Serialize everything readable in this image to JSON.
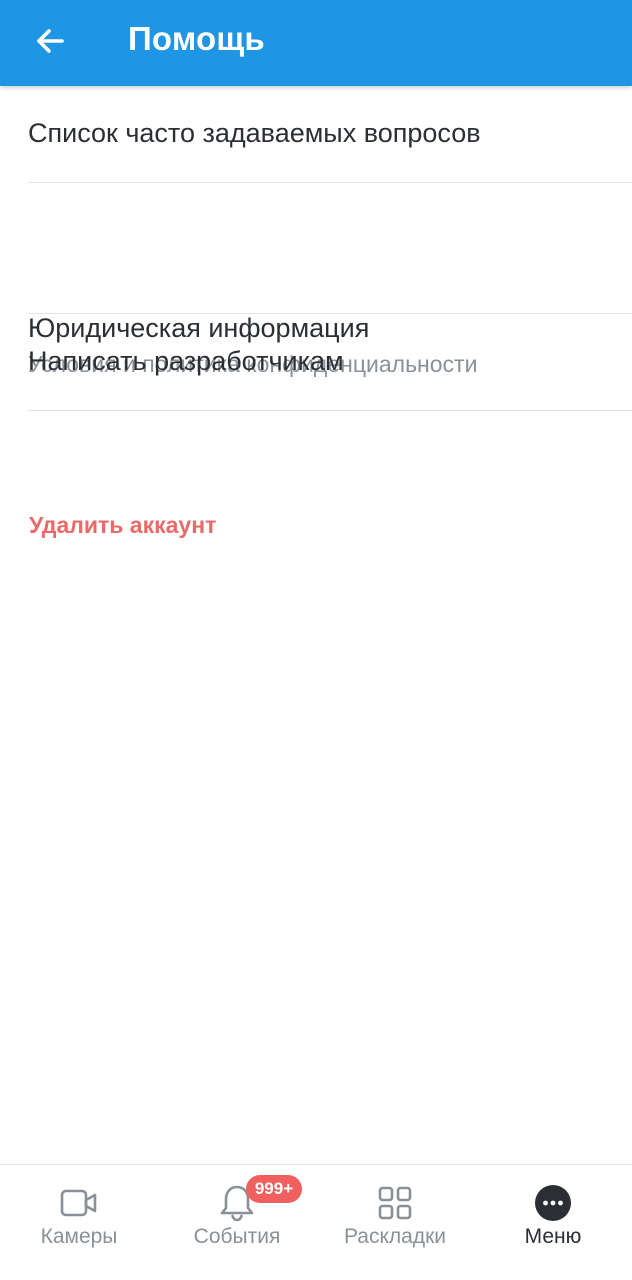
{
  "header": {
    "title": "Помощь",
    "back_icon": "arrow-left-icon",
    "background_color": "#1e96e3"
  },
  "list": {
    "items": [
      {
        "title": "Список часто задаваемых вопросов"
      },
      {
        "title": "Юридическая информация",
        "subtitle": "Условия и политика конфиденциальности"
      },
      {
        "title": "Написать разработчикам"
      }
    ]
  },
  "delete_account": {
    "label": "Удалить аккаунт",
    "color": "#eb6a68"
  },
  "bottom_nav": {
    "items": [
      {
        "label": "Камеры",
        "icon": "video-camera-icon",
        "active": false
      },
      {
        "label": "События",
        "icon": "bell-icon",
        "badge": "999+",
        "active": false
      },
      {
        "label": "Раскладки",
        "icon": "grid-icon",
        "active": false
      },
      {
        "label": "Меню",
        "icon": "more-dots-icon",
        "active": true
      }
    ],
    "badge_color": "#f0605f"
  }
}
